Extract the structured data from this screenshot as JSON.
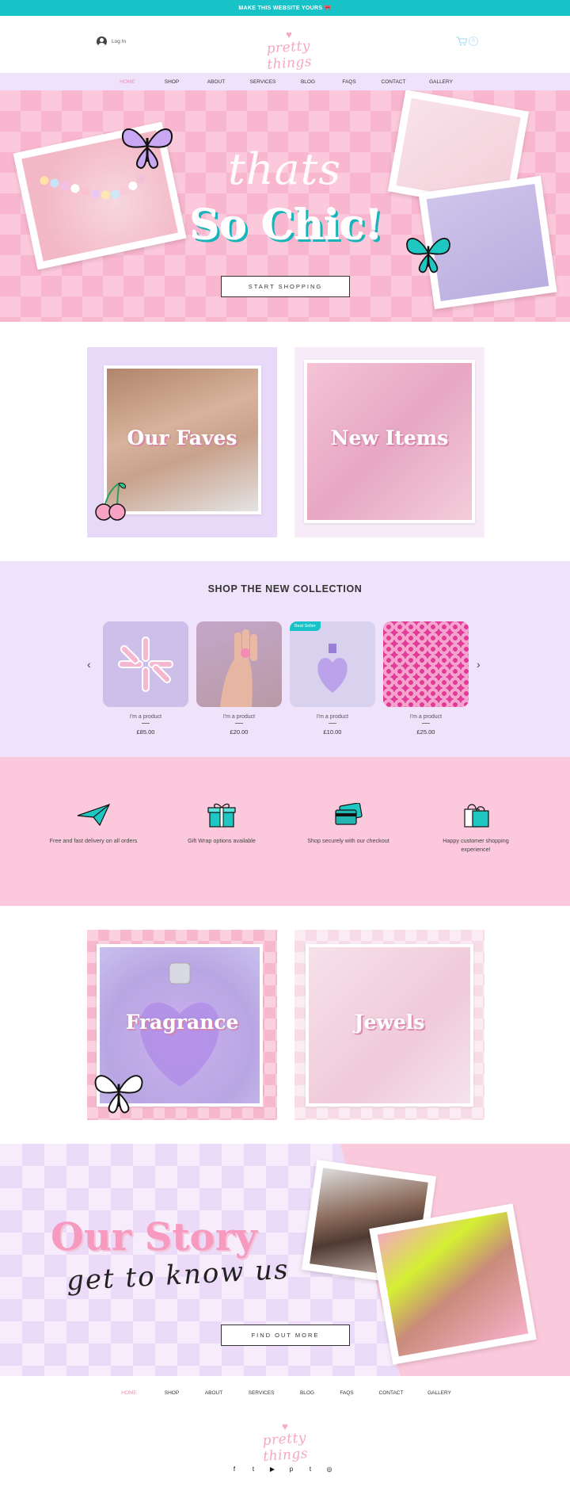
{
  "banner": {
    "text": "MAKE THIS WEBSITE YOURS 🎀"
  },
  "header": {
    "login": "Log In",
    "logo": "pretty things",
    "cart_count": "0"
  },
  "nav": [
    "HOME",
    "SHOP",
    "ABOUT",
    "SERVICES",
    "BLOG",
    "FAQS",
    "CONTACT",
    "GALLERY"
  ],
  "hero": {
    "thats": "thats",
    "chic": "So Chic!",
    "cta": "START SHOPPING"
  },
  "tiles": {
    "faves": "Our Faves",
    "new_items": "New Items",
    "fragrance": "Fragrance",
    "jewels": "Jewels"
  },
  "collection": {
    "title": "SHOP THE NEW COLLECTION",
    "products": [
      {
        "name": "I'm a product",
        "price": "£85.00",
        "badge": ""
      },
      {
        "name": "I'm a product",
        "price": "£20.00",
        "badge": ""
      },
      {
        "name": "I'm a product",
        "price": "£10.00",
        "badge": "Best Seller"
      },
      {
        "name": "I'm a product",
        "price": "£25.00",
        "badge": ""
      }
    ]
  },
  "features": [
    {
      "icon": "paper-plane-icon",
      "label": "Free and fast delivery on all orders"
    },
    {
      "icon": "gift-box-icon",
      "label": "Gift Wrap options available"
    },
    {
      "icon": "credit-card-icon",
      "label": "Shop securely with our checkout"
    },
    {
      "icon": "shopping-bag-icon",
      "label": "Happy customer shopping experience!"
    }
  ],
  "story": {
    "title": "Our Story",
    "sub": "get to know us",
    "cta": "FIND OUT MORE"
  },
  "footer": {
    "nav": [
      "HOME",
      "SHOP",
      "ABOUT",
      "SERVICES",
      "BLOG",
      "FAQS",
      "CONTACT",
      "GALLERY"
    ],
    "logo": "pretty things",
    "social": [
      "f",
      "t",
      "▶",
      "p",
      "t",
      "◎"
    ]
  },
  "colors": {
    "accent": "#17c3c6",
    "pink": "#fcc8dc",
    "lavender": "#efe3fc",
    "active": "#f48bb5"
  }
}
